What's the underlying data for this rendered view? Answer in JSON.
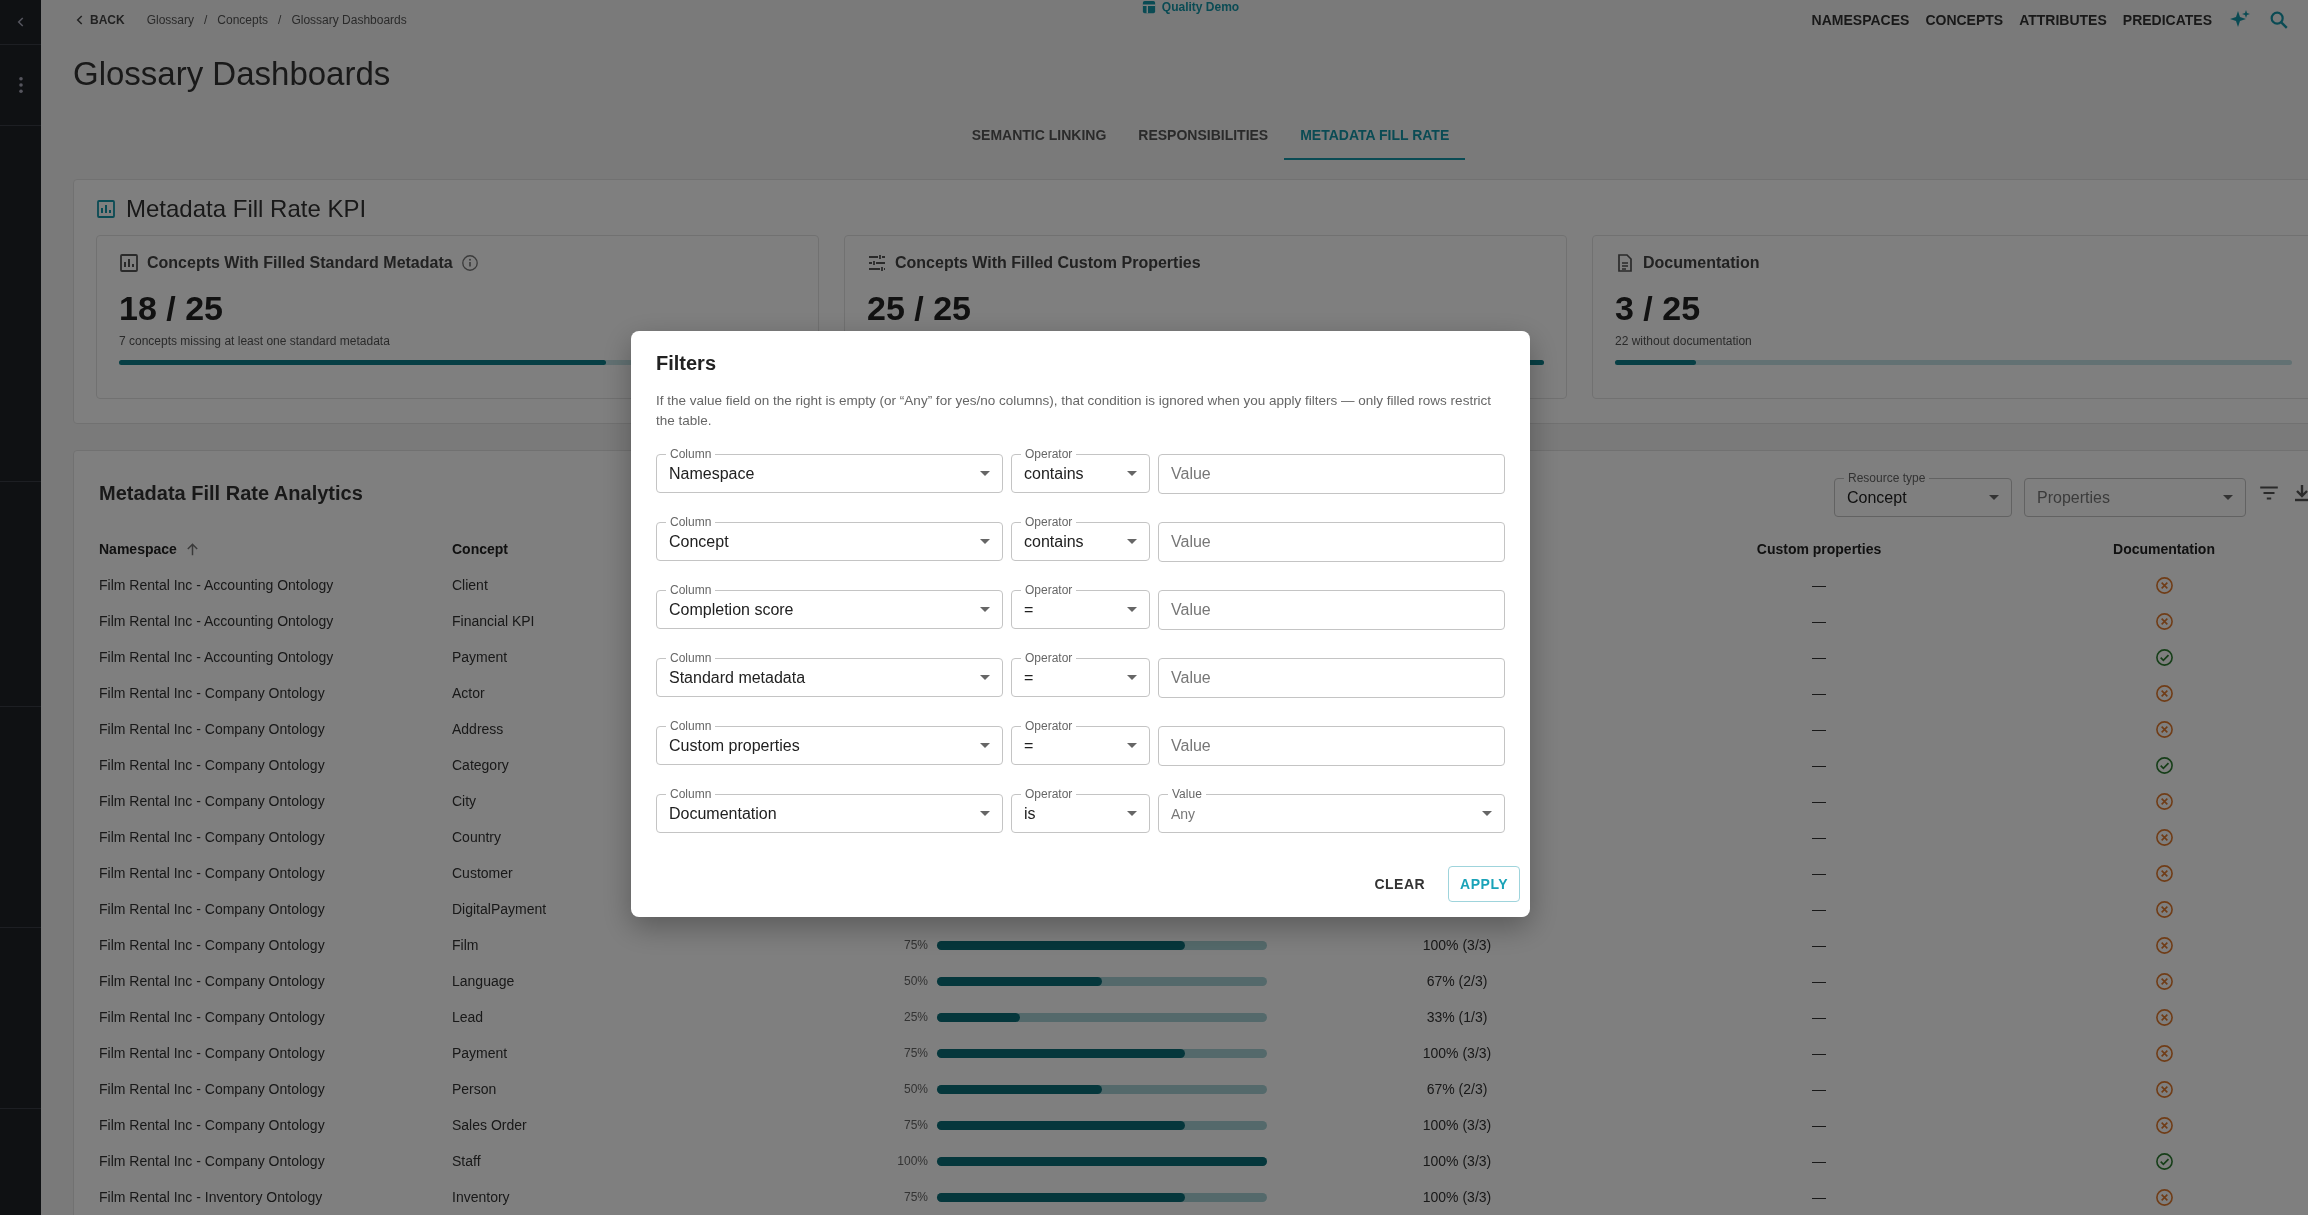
{
  "breadcrumbs": {
    "back": "BACK",
    "items": [
      {
        "label": "Glossary",
        "separator": "/"
      },
      {
        "label": "Concepts",
        "separator": "/"
      },
      {
        "label": "Glossary Dashboards"
      }
    ]
  },
  "workspace": "Quality Demo",
  "nav": [
    "NAMESPACES",
    "CONCEPTS",
    "ATTRIBUTES",
    "PREDICATES"
  ],
  "page_title": "Glossary Dashboards",
  "tabs": [
    {
      "label": "SEMANTIC LINKING",
      "selected": false
    },
    {
      "label": "RESPONSIBILITIES",
      "selected": false
    },
    {
      "label": "METADATA FILL RATE",
      "selected": true
    }
  ],
  "kpi": {
    "title": "Metadata Fill Rate KPI",
    "cards": [
      {
        "title": "Concepts With Filled Standard Metadata",
        "value": "18 / 25",
        "caption": "7 concepts missing at least one standard metadata",
        "level": 0.72
      },
      {
        "title": "Concepts With Filled Custom Properties",
        "value": "25 / 25",
        "level": 1
      },
      {
        "title": "Documentation",
        "value": "3 / 25",
        "caption": "22 without documentation",
        "level": 0.12
      }
    ]
  },
  "analytics": {
    "title": "Metadata Fill Rate Analytics",
    "resource_type": {
      "label": "Resource type",
      "value": "Concept"
    },
    "properties": {
      "placeholder": "Properties"
    },
    "table": {
      "columns": {
        "namespace": {
          "label": "Namespace",
          "sorted": true
        },
        "concept": {
          "label": "Concept",
          "sorted": false
        },
        "custom_properties": {
          "label": "Custom properties",
          "sorted": false
        },
        "documentation": {
          "label": "Documentation",
          "sorted": false
        }
      },
      "rows": [
        {
          "namespace": "Film Rental Inc - Accounting Ontology",
          "concept": "Client",
          "custom_properties": "—",
          "documented": false
        },
        {
          "namespace": "Film Rental Inc - Accounting Ontology",
          "concept": "Financial KPI",
          "custom_properties": "—",
          "documented": false
        },
        {
          "namespace": "Film Rental Inc - Accounting Ontology",
          "concept": "Payment",
          "custom_properties": "—",
          "documented": true
        },
        {
          "namespace": "Film Rental Inc - Company Ontology",
          "concept": "Actor",
          "custom_properties": "—",
          "documented": false
        },
        {
          "namespace": "Film Rental Inc - Company Ontology",
          "concept": "Address",
          "custom_properties": "—",
          "documented": false
        },
        {
          "namespace": "Film Rental Inc - Company Ontology",
          "concept": "Category",
          "custom_properties": "—",
          "documented": true
        },
        {
          "namespace": "Film Rental Inc - Company Ontology",
          "concept": "City",
          "custom_properties": "—",
          "documented": false
        },
        {
          "namespace": "Film Rental Inc - Company Ontology",
          "concept": "Country",
          "custom_properties": "—",
          "documented": false
        },
        {
          "namespace": "Film Rental Inc - Company Ontology",
          "concept": "Customer",
          "custom_properties": "—",
          "documented": false
        },
        {
          "namespace": "Film Rental Inc - Company Ontology",
          "concept": "DigitalPayment",
          "custom_properties": "—",
          "documented": false
        },
        {
          "namespace": "Film Rental Inc - Company Ontology",
          "concept": "Film",
          "completion": {
            "reading": "75%",
            "level": 0.75
          },
          "standard_metadata": "100% (3/3)",
          "custom_properties": "—",
          "documented": false
        },
        {
          "namespace": "Film Rental Inc - Company Ontology",
          "concept": "Language",
          "completion": {
            "reading": "50%",
            "level": 0.5
          },
          "standard_metadata": "67% (2/3)",
          "custom_properties": "—",
          "documented": false
        },
        {
          "namespace": "Film Rental Inc - Company Ontology",
          "concept": "Lead",
          "completion": {
            "reading": "25%",
            "level": 0.25
          },
          "standard_metadata": "33% (1/3)",
          "custom_properties": "—",
          "documented": false
        },
        {
          "namespace": "Film Rental Inc - Company Ontology",
          "concept": "Payment",
          "completion": {
            "reading": "75%",
            "level": 0.75
          },
          "standard_metadata": "100% (3/3)",
          "custom_properties": "—",
          "documented": false
        },
        {
          "namespace": "Film Rental Inc - Company Ontology",
          "concept": "Person",
          "completion": {
            "reading": "50%",
            "level": 0.5
          },
          "standard_metadata": "67% (2/3)",
          "custom_properties": "—",
          "documented": false
        },
        {
          "namespace": "Film Rental Inc - Company Ontology",
          "concept": "Sales Order",
          "completion": {
            "reading": "75%",
            "level": 0.75
          },
          "standard_metadata": "100% (3/3)",
          "custom_properties": "—",
          "documented": false
        },
        {
          "namespace": "Film Rental Inc - Company Ontology",
          "concept": "Staff",
          "completion": {
            "reading": "100%",
            "level": 1
          },
          "standard_metadata": "100% (3/3)",
          "custom_properties": "—",
          "documented": true
        },
        {
          "namespace": "Film Rental Inc - Inventory Ontology",
          "concept": "Inventory",
          "completion": {
            "reading": "75%",
            "level": 0.75
          },
          "standard_metadata": "100% (3/3)",
          "custom_properties": "—",
          "documented": false
        }
      ]
    }
  },
  "filters_dialog": {
    "title": "Filters",
    "note": "If the value field on the right is empty (or “Any” for yes/no columns), that condition is ignored when you apply filters — only filled rows restrict the table.",
    "rows": [
      {
        "column": {
          "label": "Column",
          "value": "Namespace"
        },
        "operator": {
          "label": "Operator",
          "value": "contains"
        },
        "value": {
          "kind": "text",
          "placeholder": "Value"
        }
      },
      {
        "column": {
          "label": "Column",
          "value": "Concept"
        },
        "operator": {
          "label": "Operator",
          "value": "contains"
        },
        "value": {
          "kind": "text",
          "placeholder": "Value"
        }
      },
      {
        "column": {
          "label": "Column",
          "value": "Completion score"
        },
        "operator": {
          "label": "Operator",
          "value": "="
        },
        "value": {
          "kind": "text",
          "placeholder": "Value"
        }
      },
      {
        "column": {
          "label": "Column",
          "value": "Standard metadata"
        },
        "operator": {
          "label": "Operator",
          "value": "="
        },
        "value": {
          "kind": "text",
          "placeholder": "Value"
        }
      },
      {
        "column": {
          "label": "Column",
          "value": "Custom properties"
        },
        "operator": {
          "label": "Operator",
          "value": "="
        },
        "value": {
          "kind": "text",
          "placeholder": "Value"
        }
      },
      {
        "column": {
          "label": "Column",
          "value": "Documentation"
        },
        "operator": {
          "label": "Operator",
          "value": "is"
        },
        "value": {
          "kind": "select",
          "label": "Value",
          "value": "Any"
        }
      }
    ],
    "buttons": [
      {
        "label": "CLEAR",
        "kind": "text"
      },
      {
        "label": "APPLY",
        "kind": "outlined"
      }
    ]
  }
}
